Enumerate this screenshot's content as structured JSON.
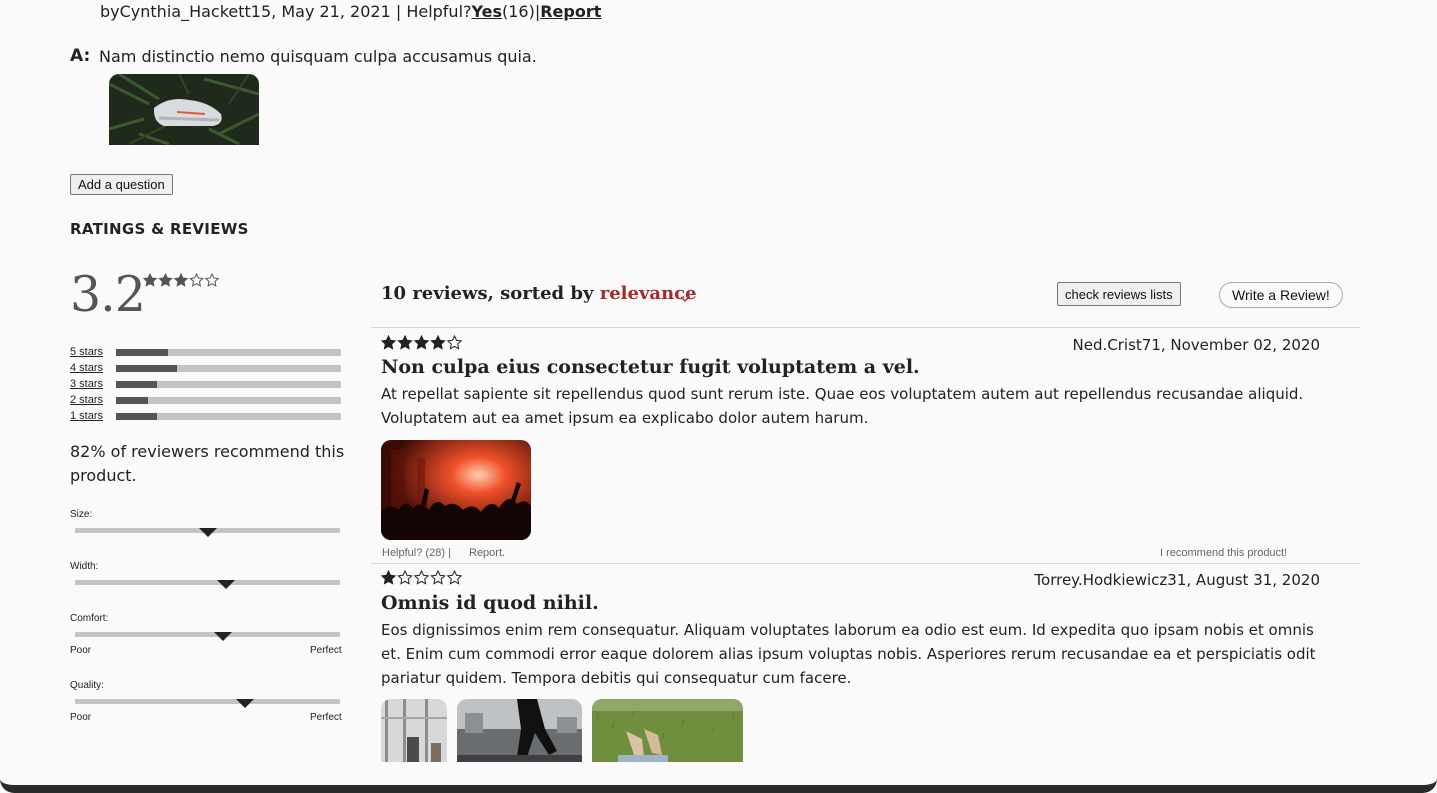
{
  "qa": {
    "by_label": "by",
    "answerer": "Cynthia_Hackett15",
    "date": "May 21, 2021",
    "helpful_label": "Helpful?",
    "yes_label": "Yes",
    "yes_count": "(16)",
    "report_label": "Report",
    "answer_label": "A:",
    "answer_text": "Nam distinctio nemo quisquam culpa accusamus quia.",
    "add_question_label": "Add a question"
  },
  "ratings": {
    "heading": "RATINGS & REVIEWS",
    "average": "3.2",
    "average_stars": 3.2,
    "breakdown": [
      {
        "label": "5 stars",
        "fraction": 0.23
      },
      {
        "label": "4 stars",
        "fraction": 0.27
      },
      {
        "label": "3 stars",
        "fraction": 0.18
      },
      {
        "label": "2 stars",
        "fraction": 0.14
      },
      {
        "label": "1 stars",
        "fraction": 0.18
      }
    ],
    "recommend_text": "82% of reviewers recommend this product.",
    "characteristics": [
      {
        "name": "Size:",
        "position": 0.5,
        "low": "",
        "high": ""
      },
      {
        "name": "Width:",
        "position": 0.57,
        "low": "",
        "high": ""
      },
      {
        "name": "Comfort:",
        "position": 0.56,
        "low": "Poor",
        "high": "Perfect"
      },
      {
        "name": "Quality:",
        "position": 0.64,
        "low": "Poor",
        "high": "Perfect"
      }
    ]
  },
  "reviews": {
    "count_text": "10 reviews, sorted by",
    "sort_value": "relevance",
    "check_button": "check reviews lists",
    "write_button": "Write a Review!",
    "items": [
      {
        "stars": 4,
        "author_date": "Ned.Crist71, November 02, 2020",
        "summary": "Non culpa eius consectetur fugit voluptatem a vel.",
        "body": "At repellat sapiente sit repellendus quod sunt rerum iste. Quae eos voluptatem autem aut repellendus recusandae aliquid. Voluptatem aut ea amet ipsum ea explicabo dolor autem harum.",
        "helpful_text": "Helpful? (28) |",
        "report_text": "Report.",
        "recommend_text": "I recommend this product!"
      },
      {
        "stars": 1,
        "author_date": "Torrey.Hodkiewicz31, August 31, 2020",
        "summary": "Omnis id quod nihil.",
        "body": "Eos dignissimos enim rem consequatur. Aliquam voluptates laborum ea odio est eum. Id expedita quo ipsam nobis et omnis et. Enim cum commodi error eaque dolorem alias ipsum voluptas nobis. Asperiores rerum recusandae ea et perspiciatis odit pariatur quidem. Tempora debitis qui consequatur cum facere."
      }
    ]
  },
  "colors": {
    "accent": "#a52a2a",
    "bar_fill": "#555555",
    "bar_track": "#c4c4c4"
  }
}
